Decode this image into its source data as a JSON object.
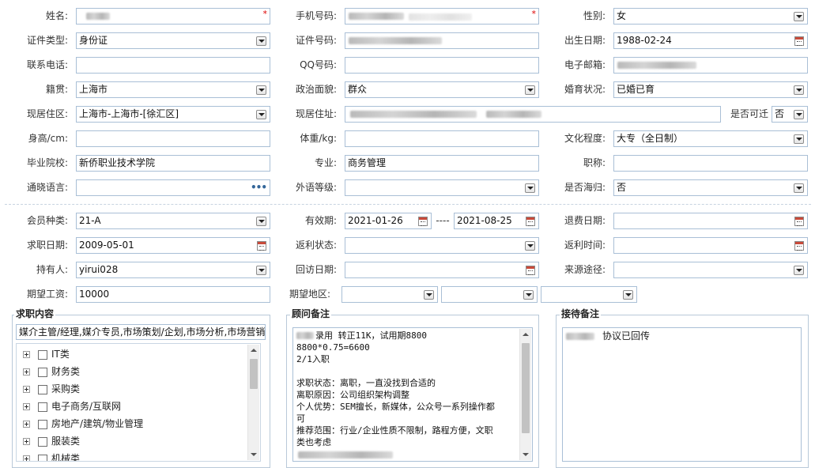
{
  "form": {
    "name_label": "姓名:",
    "mobile_label": "手机号码:",
    "gender_label": "性别:",
    "gender_value": "女",
    "id_type_label": "证件类型:",
    "id_type_value": "身份证",
    "id_no_label": "证件号码:",
    "birth_label": "出生日期:",
    "birth_value": "1988-02-24",
    "phone_label": "联系电话:",
    "qq_label": "QQ号码:",
    "email_label": "电子邮箱:",
    "native_label": "籍贯:",
    "native_value": "上海市",
    "political_label": "政治面貌:",
    "political_value": "群众",
    "marital_label": "婚育状况:",
    "marital_value": "已婚已育",
    "res_area_label": "现居住区:",
    "res_area_value": "上海市-上海市-[徐汇区]",
    "res_addr_label": "现居住址:",
    "relocate_label": "是否可迁",
    "relocate_value": "否",
    "height_label": "身高/cm:",
    "weight_label": "体重/kg:",
    "edu_label": "文化程度:",
    "edu_value": "大专（全日制）",
    "school_label": "毕业院校:",
    "school_value": "新侨职业技术学院",
    "major_label": "专业:",
    "major_value": "商务管理",
    "title_label": "职称:",
    "lang_label": "通晓语言:",
    "lang_level_label": "外语等级:",
    "overseas_label": "是否海归:",
    "overseas_value": "否",
    "member_type_label": "会员种类:",
    "member_type_value": "21-A",
    "valid_label": "有效期:",
    "valid_from": "2021-01-26",
    "valid_sep": "----",
    "valid_to": "2021-08-25",
    "refund_label": "退费日期:",
    "job_date_label": "求职日期:",
    "job_date_value": "2009-05-01",
    "rebate_status_label": "返利状态:",
    "rebate_time_label": "返利时间:",
    "holder_label": "持有人:",
    "holder_value": "yirui028",
    "revisit_label": "回访日期:",
    "source_label": "来源途径:",
    "salary_label": "期望工资:",
    "salary_value": "10000",
    "region_label": "期望地区:"
  },
  "panels": {
    "job_title": "求职内容",
    "job_summary": "媒介主管/经理,媒介专员,市场策划/企划,市场分析,市场营销",
    "categories": [
      "IT类",
      "财务类",
      "采购类",
      "电子商务/互联网",
      "房地产/建筑/物业管理",
      "服装类",
      "机械类"
    ],
    "advisor_title": "顾问备注",
    "advisor_notes": [
      "录用 转正11K，试用期8800",
      "8800*0.75=6600",
      "2/1入职",
      "",
      "求职状态：离职，一直没找到合适的",
      "离职原因：公司组织架构调整",
      "个人优势：SEM擅长，新媒体，公众号一系列操作都",
      "可",
      "推荐范围：行业/企业性质不限制，路程方便，文职",
      "类也考虑"
    ],
    "reception_title": "接待备注",
    "reception_note": "协议已回传"
  }
}
